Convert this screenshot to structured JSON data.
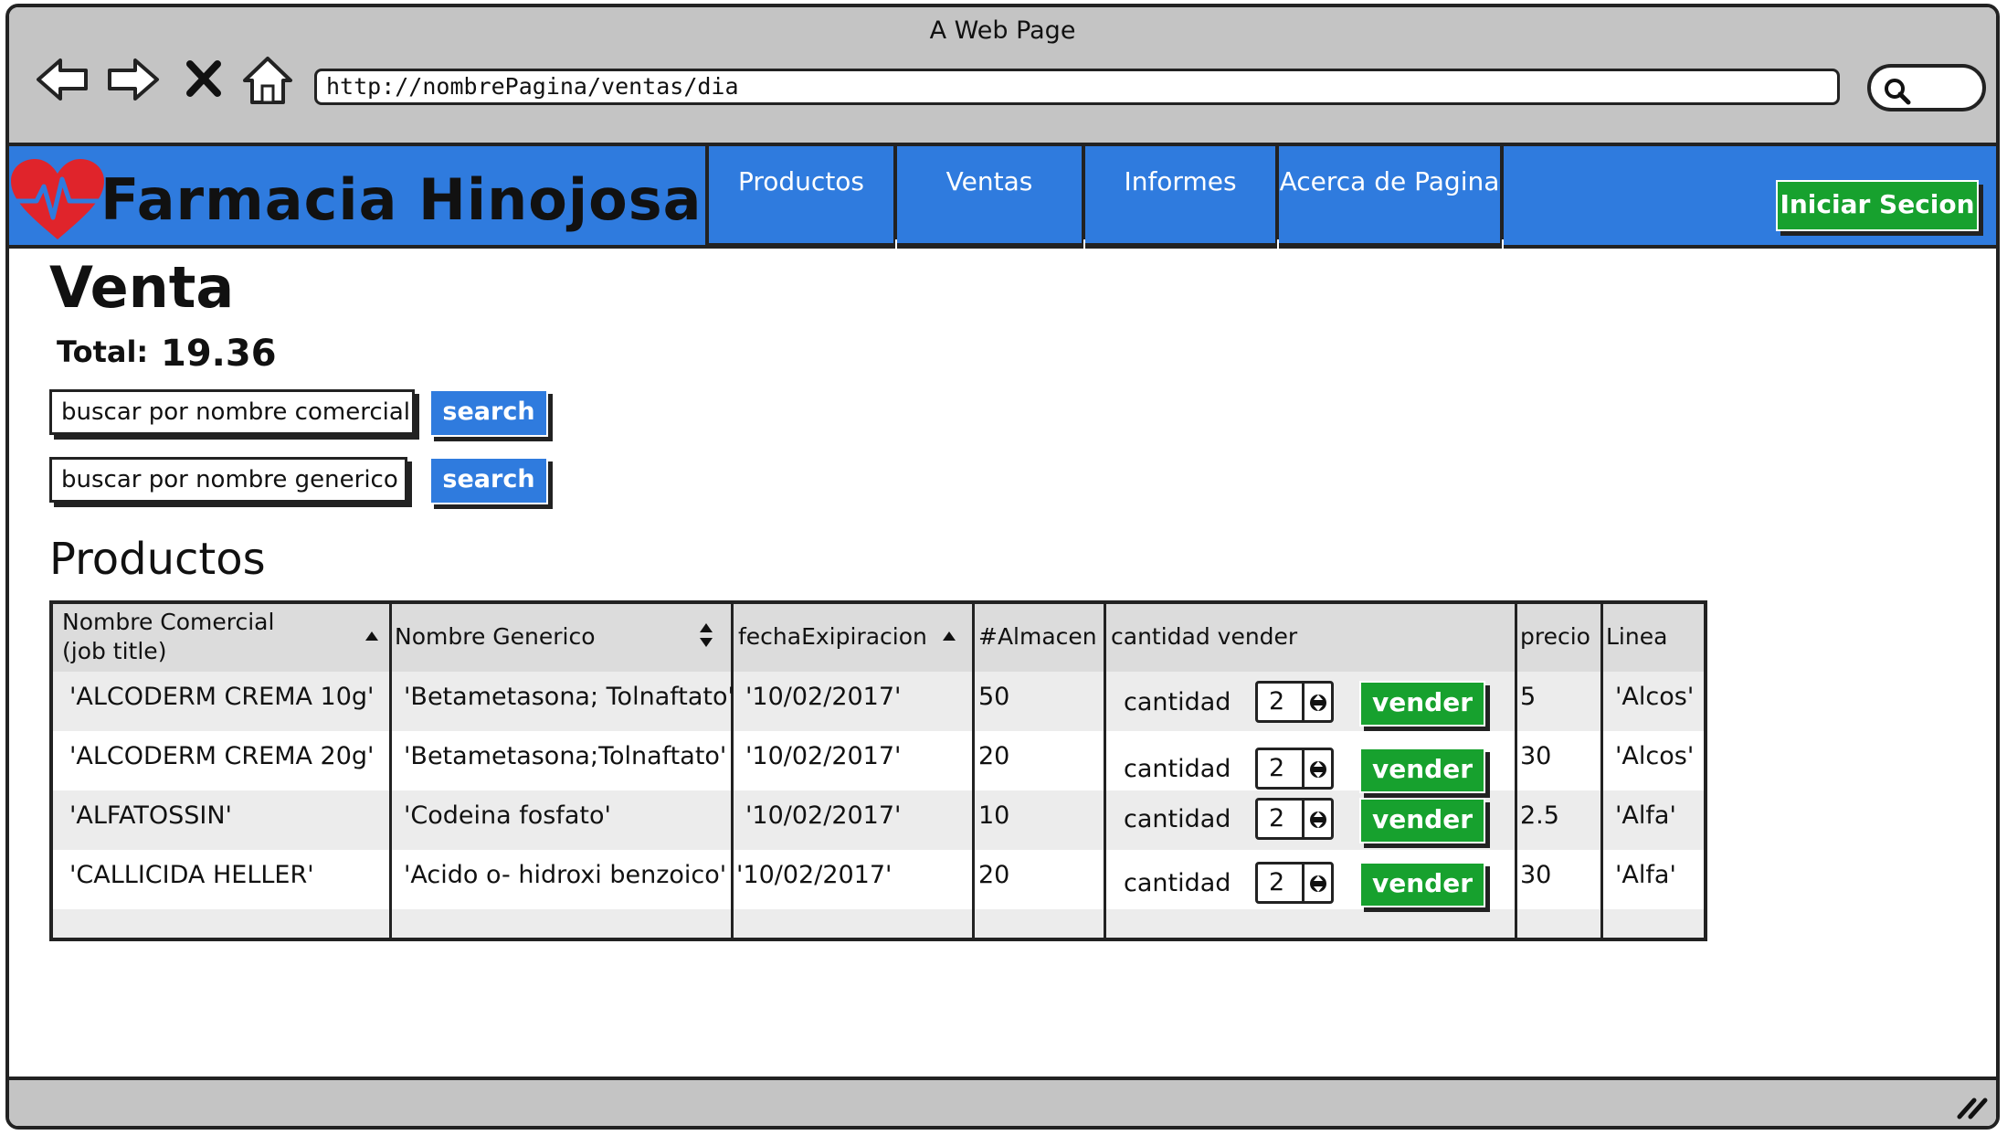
{
  "browser": {
    "window_title": "A Web Page",
    "url": "http://nombrePagina/ventas/dia",
    "icons": [
      "back-icon",
      "forward-icon",
      "close-icon",
      "home-icon",
      "search-icon"
    ]
  },
  "header": {
    "brand": "Farmacia Hinojosa",
    "logo_icon": "heart-pulse-icon",
    "nav": [
      {
        "label": "Productos"
      },
      {
        "label": "Ventas"
      },
      {
        "label": "Informes"
      },
      {
        "label": "Acerca de Pagina"
      }
    ],
    "login_label": "Iniciar Secion",
    "colors": {
      "header": "#2f7bde",
      "button_green": "#17a12e",
      "chrome": "#c4c4c4"
    }
  },
  "main": {
    "title": "Venta",
    "total_label": "Total:",
    "total_value": "19.36",
    "search_comercial": {
      "value": "buscar por nombre comercial",
      "button": "search"
    },
    "search_generico": {
      "value": "buscar por nombre generico",
      "button": "search"
    },
    "section_title": "Productos"
  },
  "table": {
    "columns": [
      {
        "line1": "Nombre Comercial",
        "line2": "(job title)",
        "sort": "asc"
      },
      {
        "line1": "Nombre Generico",
        "sort": "both"
      },
      {
        "line1": "fechaExipiracion",
        "sort": "asc"
      },
      {
        "line1": "#Almacen"
      },
      {
        "line1": "cantidad vender"
      },
      {
        "line1": "precio"
      },
      {
        "line1": "Linea"
      }
    ],
    "rows": [
      {
        "nombre": "'ALCODERM CREMA 10g'",
        "generico": "'Betametasona; Tolnaftato'",
        "fecha": "'10/02/2017'",
        "almacen": "50",
        "cantidad_label": "cantidad",
        "cantidad": "2",
        "vender": "vender",
        "precio": "5",
        "linea": "'Alcos'"
      },
      {
        "nombre": "'ALCODERM CREMA 20g'",
        "generico": "'Betametasona;Tolnaftato'",
        "fecha": "'10/02/2017'",
        "almacen": "20",
        "cantidad_label": "cantidad",
        "cantidad": "2",
        "vender": "vender",
        "precio": "30",
        "linea": "'Alcos'"
      },
      {
        "nombre": "'ALFATOSSIN'",
        "generico": "'Codeina fosfato'",
        "fecha": "'10/02/2017'",
        "almacen": "10",
        "cantidad_label": "cantidad",
        "cantidad": "2",
        "vender": "vender",
        "precio": "2.5",
        "linea": "'Alfa'"
      },
      {
        "nombre": "'CALLICIDA HELLER'",
        "generico": "'Acido o- hidroxi benzoico'",
        "fecha": "'10/02/2017'",
        "almacen": "20",
        "cantidad_label": "cantidad",
        "cantidad": "2",
        "vender": "vender",
        "precio": "30",
        "linea": "'Alfa'"
      }
    ]
  }
}
